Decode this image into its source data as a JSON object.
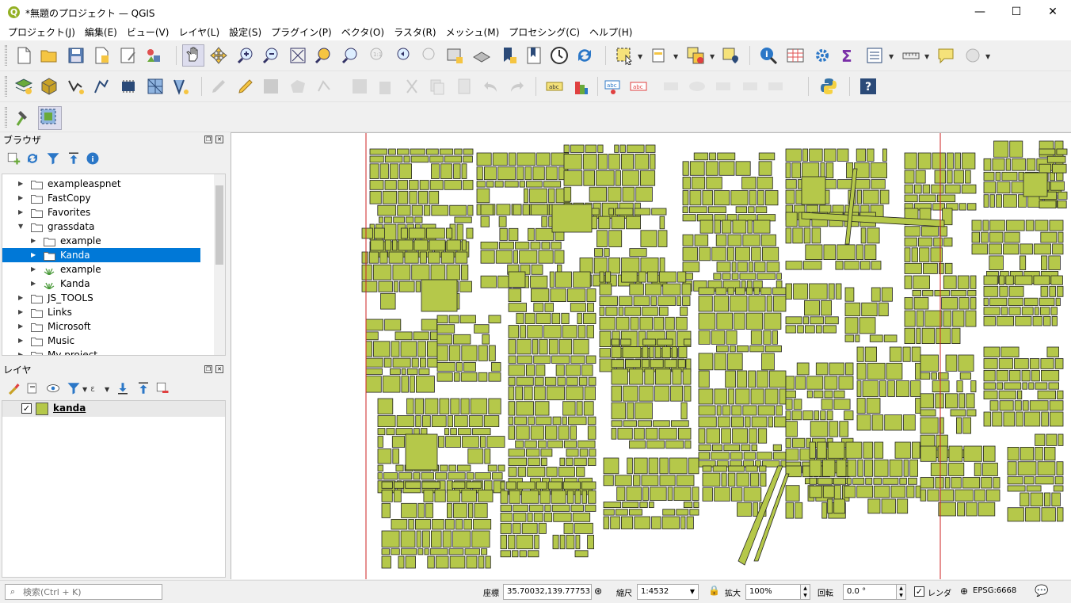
{
  "window": {
    "title": "*無題のプロジェクト — QGIS",
    "app_icon_letter": "Q",
    "controls": {
      "minimize": "—",
      "maximize": "☐",
      "close": "✕"
    }
  },
  "menu": [
    "プロジェクト(J)",
    "編集(E)",
    "ビュー(V)",
    "レイヤ(L)",
    "設定(S)",
    "プラグイン(P)",
    "ベクタ(O)",
    "ラスタ(R)",
    "メッシュ(M)",
    "プロセシング(C)",
    "ヘルプ(H)"
  ],
  "browser": {
    "title": "ブラウザ",
    "items": [
      {
        "label": "exampleaspnet",
        "type": "folder",
        "indent": 0,
        "expanded": false,
        "selected": false
      },
      {
        "label": "FastCopy",
        "type": "folder",
        "indent": 0,
        "expanded": false,
        "selected": false
      },
      {
        "label": "Favorites",
        "type": "folder",
        "indent": 0,
        "expanded": false,
        "selected": false
      },
      {
        "label": "grassdata",
        "type": "folder",
        "indent": 0,
        "expanded": true,
        "selected": false
      },
      {
        "label": "example",
        "type": "folder",
        "indent": 1,
        "expanded": false,
        "selected": false
      },
      {
        "label": "Kanda",
        "type": "folder",
        "indent": 1,
        "expanded": false,
        "selected": true
      },
      {
        "label": "example",
        "type": "grass",
        "indent": 1,
        "expanded": false,
        "selected": false
      },
      {
        "label": "Kanda",
        "type": "grass",
        "indent": 1,
        "expanded": false,
        "selected": false
      },
      {
        "label": "JS_TOOLS",
        "type": "folder",
        "indent": 0,
        "expanded": false,
        "selected": false
      },
      {
        "label": "Links",
        "type": "folder",
        "indent": 0,
        "expanded": false,
        "selected": false
      },
      {
        "label": "Microsoft",
        "type": "folder",
        "indent": 0,
        "expanded": false,
        "selected": false
      },
      {
        "label": "Music",
        "type": "folder",
        "indent": 0,
        "expanded": false,
        "selected": false
      },
      {
        "label": "My project",
        "type": "folder",
        "indent": 0,
        "expanded": false,
        "selected": false
      }
    ]
  },
  "layers": {
    "title": "レイヤ",
    "items": [
      {
        "label": "kanda",
        "checked": true,
        "color": "#b5c84a"
      }
    ]
  },
  "status": {
    "search_placeholder": "検索(Ctrl + K)",
    "coord_label": "座標",
    "coord_value": "35.70032,139.77753",
    "scale_label": "縮尺",
    "scale_value": "1:4532",
    "magnifier_label": "拡大",
    "magnifier_value": "100%",
    "rotation_label": "回転",
    "rotation_value": "0.0 °",
    "render_label": "レンダ",
    "render_checked": true,
    "crs": "EPSG:6668"
  },
  "colors": {
    "polygon_fill": "#b5c84a",
    "polygon_stroke": "#222222",
    "frame_line": "#cc2222",
    "selection": "#0078d7"
  }
}
